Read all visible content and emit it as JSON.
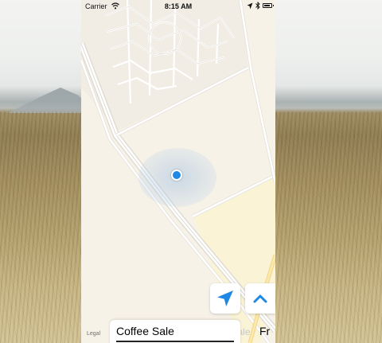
{
  "status_bar": {
    "carrier": "Carrier",
    "time": "8:15 AM",
    "battery_level": 0.9
  },
  "map": {
    "legal_label": "Legal",
    "locate_icon": "location-arrow-icon",
    "expand_icon": "chevron-up-icon",
    "accent_color": "#1f88e5"
  },
  "cards": [
    {
      "title": "Coffee Sale"
    },
    {
      "title": "Coffee Sale"
    },
    {
      "title": "Fr"
    }
  ]
}
